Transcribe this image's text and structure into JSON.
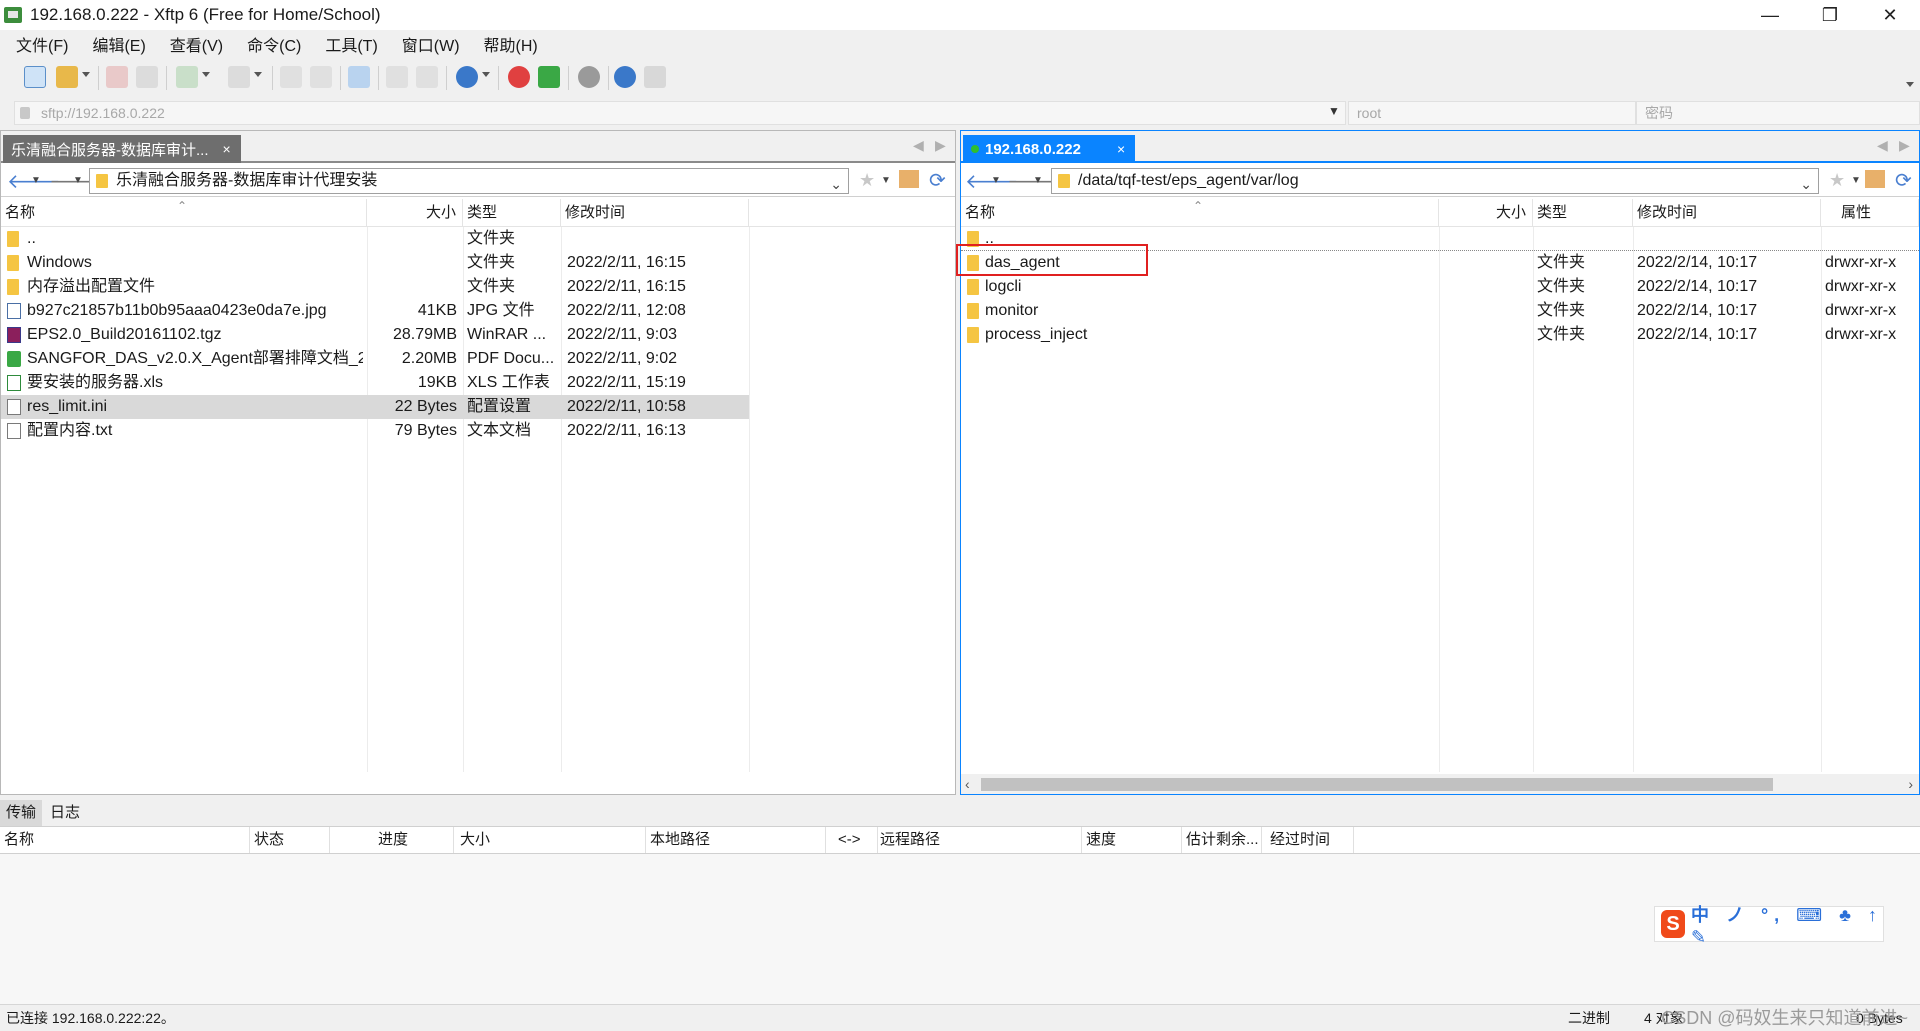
{
  "window": {
    "title": "192.168.0.222 - Xftp 6 (Free for Home/School)",
    "minimize": "—",
    "maximize": "❐",
    "close": "✕"
  },
  "menu": [
    "文件(F)",
    "编辑(E)",
    "查看(V)",
    "命令(C)",
    "工具(T)",
    "窗口(W)",
    "帮助(H)"
  ],
  "address": {
    "url_placeholder": "sftp://192.168.0.222",
    "user_placeholder": "root",
    "password_placeholder": "密码"
  },
  "left_pane": {
    "tab_label": "乐清融合服务器-数据库审计...",
    "tab_close": "×",
    "path": "乐清融合服务器-数据库审计代理安装",
    "columns": {
      "name": "名称",
      "size": "大小",
      "type": "类型",
      "modified": "修改时间"
    },
    "files": [
      {
        "name": "..",
        "size": "",
        "type": "文件夹",
        "modified": "",
        "icon": "folder"
      },
      {
        "name": "Windows",
        "size": "",
        "type": "文件夹",
        "modified": "2022/2/11, 16:15",
        "icon": "folder"
      },
      {
        "name": "内存溢出配置文件",
        "size": "",
        "type": "文件夹",
        "modified": "2022/2/11, 16:15",
        "icon": "folder"
      },
      {
        "name": "b927c21857b11b0b95aaa0423e0da7e.jpg",
        "size": "41KB",
        "type": "JPG 文件",
        "modified": "2022/2/11, 12:08",
        "icon": "jpg"
      },
      {
        "name": "EPS2.0_Build20161102.tgz",
        "size": "28.79MB",
        "type": "WinRAR ...",
        "modified": "2022/2/11, 9:03",
        "icon": "tgz"
      },
      {
        "name": "SANGFOR_DAS_v2.0.X_Agent部署排障文档_2...",
        "size": "2.20MB",
        "type": "PDF Docu...",
        "modified": "2022/2/11, 9:02",
        "icon": "pdf"
      },
      {
        "name": "要安装的服务器.xls",
        "size": "19KB",
        "type": "XLS 工作表",
        "modified": "2022/2/11, 15:19",
        "icon": "xls"
      },
      {
        "name": "res_limit.ini",
        "size": "22 Bytes",
        "type": "配置设置",
        "modified": "2022/2/11, 10:58",
        "icon": "ini",
        "selected": true
      },
      {
        "name": "配置内容.txt",
        "size": "79 Bytes",
        "type": "文本文档",
        "modified": "2022/2/11, 16:13",
        "icon": "txt"
      }
    ]
  },
  "right_pane": {
    "tab_label": "192.168.0.222",
    "tab_close": "×",
    "path": "/data/tqf-test/eps_agent/var/log",
    "columns": {
      "name": "名称",
      "size": "大小",
      "type": "类型",
      "modified": "修改时间",
      "attrs": "属性"
    },
    "files": [
      {
        "name": "..",
        "type": "",
        "modified": "",
        "attrs": "",
        "icon": "folder"
      },
      {
        "name": "das_agent",
        "type": "文件夹",
        "modified": "2022/2/14, 10:17",
        "attrs": "drwxr-xr-x",
        "icon": "folder"
      },
      {
        "name": "logcli",
        "type": "文件夹",
        "modified": "2022/2/14, 10:17",
        "attrs": "drwxr-xr-x",
        "icon": "folder"
      },
      {
        "name": "monitor",
        "type": "文件夹",
        "modified": "2022/2/14, 10:17",
        "attrs": "drwxr-xr-x",
        "icon": "folder"
      },
      {
        "name": "process_inject",
        "type": "文件夹",
        "modified": "2022/2/14, 10:17",
        "attrs": "drwxr-xr-x",
        "icon": "folder"
      }
    ]
  },
  "transfer": {
    "tabs": [
      "传输",
      "日志"
    ],
    "columns": [
      "名称",
      "状态",
      "进度",
      "大小",
      "本地路径",
      "<->",
      "远程路径",
      "速度",
      "估计剩余...",
      "经过时间"
    ]
  },
  "ime": {
    "logo": "S",
    "text": "中 ノ °, ⌨ ♣ ↑ ✎"
  },
  "status": {
    "connection": "已连接 192.168.0.222:22。",
    "mode": "二进制",
    "objects": "4 对象",
    "size": "0 Bytes",
    "watermark": "CSDN @码奴生来只知道前进~"
  },
  "colors": {
    "accent": "#0a84ff",
    "highlight_box": "#e02020",
    "folder": "#f5c542"
  }
}
